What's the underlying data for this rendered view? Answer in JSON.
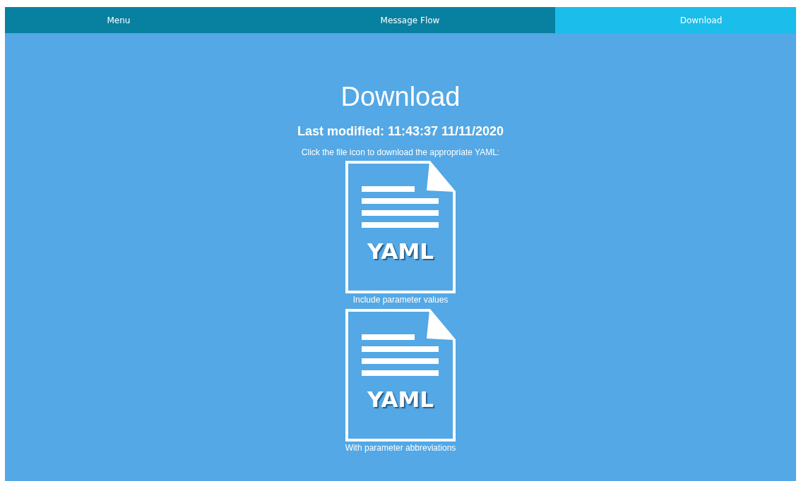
{
  "tabs": [
    {
      "label": "Menu",
      "selected": false
    },
    {
      "label": "Message Flow",
      "selected": false
    },
    {
      "label": "Download",
      "selected": true
    }
  ],
  "title": "Download",
  "last_modified": "Last modified: 11:43:37 11/11/2020",
  "instruction": "Click the file icon to download the appropriate YAML:",
  "files": [
    {
      "icon_label": "YAML",
      "caption": "Include parameter values"
    },
    {
      "icon_label": "YAML",
      "caption": "With parameter abbreviations"
    }
  ]
}
